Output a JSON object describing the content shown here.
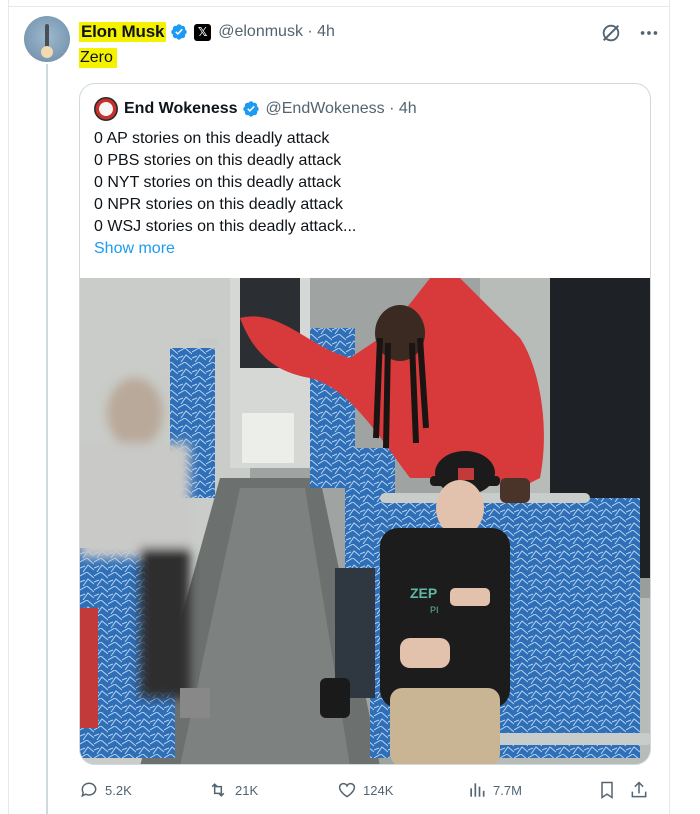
{
  "tweet": {
    "author_name": "Elon Musk",
    "handle": "@elonmusk",
    "time": "4h",
    "text": "Zero",
    "x_badge": "𝕏",
    "avatar_icon": "rocket-launch-avatar",
    "highlight_color": "#f5f200"
  },
  "quote": {
    "author_name": "End Wokeness",
    "handle": "@EndWokeness",
    "time": "4h",
    "lines": [
      "0 AP stories on this deadly attack",
      "0 PBS stories on this deadly attack",
      "0 NYT stories on this deadly attack",
      "0 NPR stories on this deadly attack",
      "0 WSJ stories on this deadly attack..."
    ],
    "show_more": "Show more",
    "media": {
      "type": "video-still",
      "description_icon": "train-interior-image",
      "shirt_text": "ZEP",
      "shirt_text_2": "PI"
    }
  },
  "actions": {
    "replies": "5.2K",
    "reposts": "21K",
    "likes": "124K",
    "views": "7.7M"
  },
  "colors": {
    "verified": "#1d9bf0",
    "muted": "#536471",
    "link": "#1d9bf0",
    "hoodie": "#d8393a",
    "seat": "#2f6fb8"
  }
}
